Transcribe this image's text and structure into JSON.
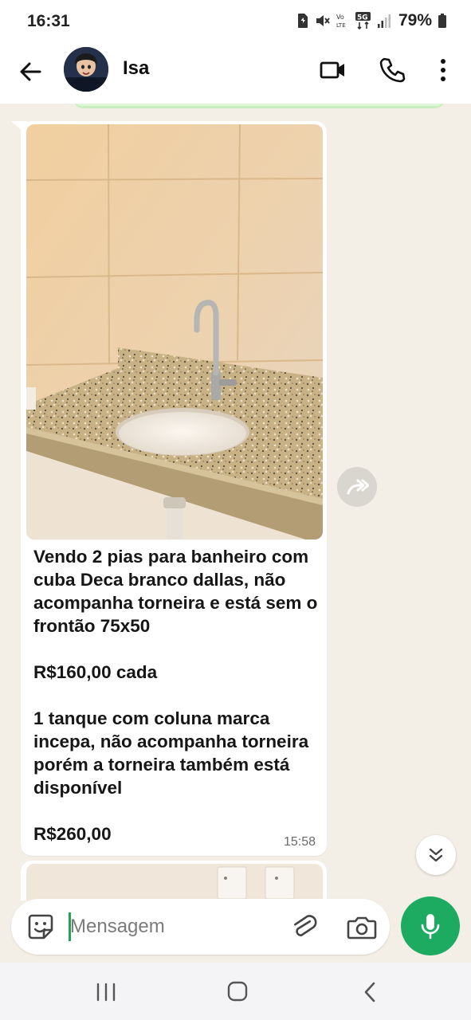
{
  "status_bar": {
    "time": "16:31",
    "battery": "79%",
    "icons": [
      "sim-icon",
      "mute-icon",
      "volte-icon",
      "5g-icon",
      "signal-icon",
      "battery-icon"
    ]
  },
  "header": {
    "contact_name": "Isa",
    "icons": [
      "back-arrow-icon",
      "avatar",
      "video-call-icon",
      "phone-call-icon",
      "more-options-icon"
    ]
  },
  "message": {
    "text": "Vendo 2 pias para banheiro com cuba Deca branco dallas, não acompanha torneira e está sem o frontão 75x50\n\nR$160,00 cada\n\n1 tanque com coluna marca incepa, não acompanha torneira porém a torneira também está disponível\n\nR$260,00",
    "time": "15:58",
    "image": "bathroom-sink-photo"
  },
  "composer": {
    "placeholder": "Mensagem",
    "icons": [
      "sticker-icon",
      "attach-icon",
      "camera-icon",
      "mic-icon"
    ]
  },
  "colors": {
    "accent_green": "#1daa61",
    "chat_background": "#f4efe6",
    "bubble": "#ffffff"
  }
}
